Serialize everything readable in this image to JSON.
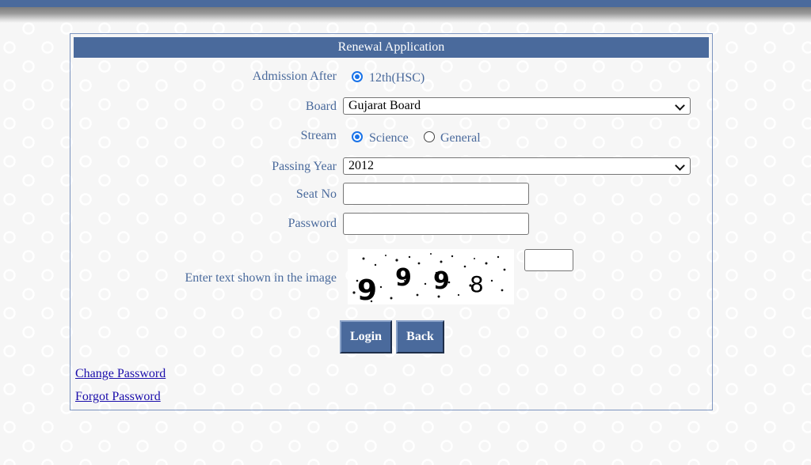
{
  "form": {
    "title": "Renewal Application",
    "admission_after": {
      "label": "Admission After",
      "options": [
        {
          "label": "12th(HSC)",
          "selected": true
        }
      ]
    },
    "board": {
      "label": "Board",
      "value": "Gujarat Board"
    },
    "stream": {
      "label": "Stream",
      "options": [
        {
          "label": "Science",
          "selected": true
        },
        {
          "label": "General",
          "selected": false
        }
      ]
    },
    "passing_year": {
      "label": "Passing Year",
      "value": "2012"
    },
    "seat_no": {
      "label": "Seat No",
      "value": ""
    },
    "password": {
      "label": "Password",
      "value": ""
    },
    "captcha": {
      "label": "Enter text shown in the image",
      "image_text": "9998",
      "value": ""
    },
    "buttons": {
      "login": "Login",
      "back": "Back"
    },
    "links": {
      "change_password": "Change Password",
      "forgot_password": "Forgot Password"
    }
  },
  "colors": {
    "accent": "#4a6a9c",
    "link": "#1a0dab",
    "radio": "#1a73e8"
  }
}
